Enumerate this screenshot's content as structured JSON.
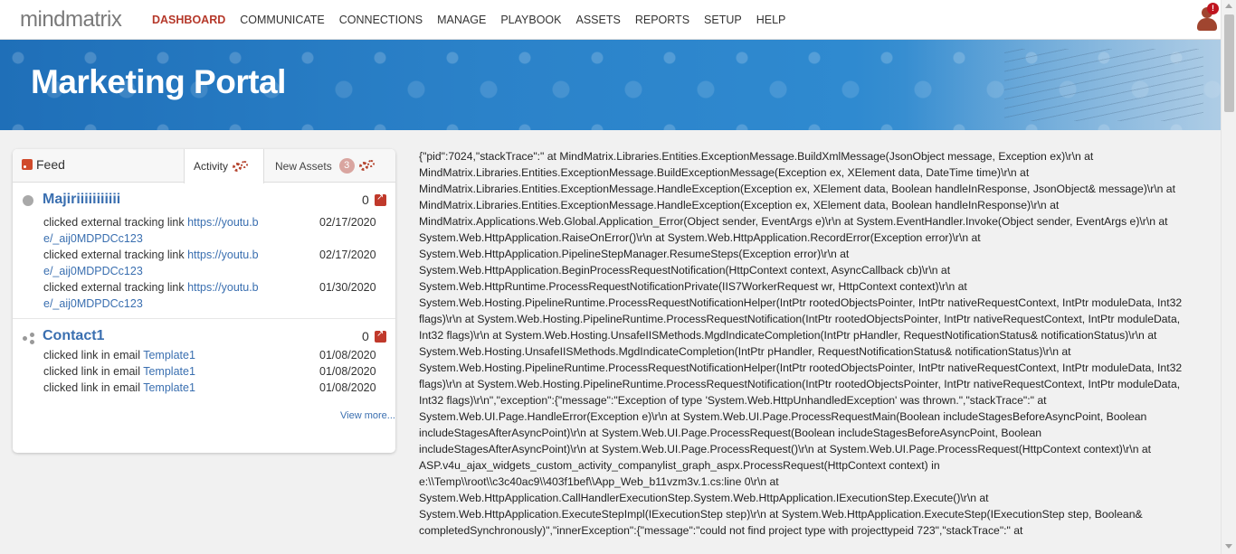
{
  "brand": {
    "logo_text": "mindmatrix"
  },
  "nav": {
    "items": [
      "DASHBOARD",
      "COMMUNICATE",
      "CONNECTIONS",
      "MANAGE",
      "PLAYBOOK",
      "ASSETS",
      "REPORTS",
      "SETUP",
      "HELP"
    ],
    "active": "DASHBOARD"
  },
  "user": {
    "alert_badge": "!"
  },
  "hero": {
    "title": "Marketing Portal"
  },
  "feed": {
    "title": "Feed",
    "tabs": {
      "activity": "Activity",
      "new_assets": "New Assets",
      "new_assets_count": "3"
    },
    "items": [
      {
        "name": "Majiriiiiiiiiiii",
        "count": "0",
        "activities": [
          {
            "text": "clicked external tracking link ",
            "link_line1": "https://youtu.b",
            "link_line2": "e/_aij0MDPDCc123",
            "date": "02/17/2020"
          },
          {
            "text": "clicked external tracking link ",
            "link_line1": "https://youtu.b",
            "link_line2": "e/_aij0MDPDCc123",
            "date": "02/17/2020"
          },
          {
            "text": "clicked external tracking link ",
            "link_line1": "https://youtu.b",
            "link_line2": "e/_aij0MDPDCc123",
            "date": "01/30/2020"
          }
        ]
      },
      {
        "name": "Contact1",
        "count": "0",
        "activities": [
          {
            "text": "clicked link in email ",
            "link": "Template1",
            "date": "01/08/2020"
          },
          {
            "text": "clicked link in email ",
            "link": "Template1",
            "date": "01/08/2020"
          },
          {
            "text": "clicked link in email ",
            "link": "Template1",
            "date": "01/08/2020"
          }
        ]
      }
    ],
    "view_more": "View more..."
  },
  "error_text": "{\"pid\":7024,\"stackTrace\":\" at MindMatrix.Libraries.Entities.ExceptionMessage.BuildXmlMessage(JsonObject message, Exception ex)\\r\\n at MindMatrix.Libraries.Entities.ExceptionMessage.BuildExceptionMessage(Exception ex, XElement data, DateTime time)\\r\\n at MindMatrix.Libraries.Entities.ExceptionMessage.HandleException(Exception ex, XElement data, Boolean handleInResponse, JsonObject& message)\\r\\n at MindMatrix.Libraries.Entities.ExceptionMessage.HandleException(Exception ex, XElement data, Boolean handleInResponse)\\r\\n at MindMatrix.Applications.Web.Global.Application_Error(Object sender, EventArgs e)\\r\\n at System.EventHandler.Invoke(Object sender, EventArgs e)\\r\\n at System.Web.HttpApplication.RaiseOnError()\\r\\n at System.Web.HttpApplication.RecordError(Exception error)\\r\\n at System.Web.HttpApplication.PipelineStepManager.ResumeSteps(Exception error)\\r\\n at System.Web.HttpApplication.BeginProcessRequestNotification(HttpContext context, AsyncCallback cb)\\r\\n at System.Web.HttpRuntime.ProcessRequestNotificationPrivate(IIS7WorkerRequest wr, HttpContext context)\\r\\n at System.Web.Hosting.PipelineRuntime.ProcessRequestNotificationHelper(IntPtr rootedObjectsPointer, IntPtr nativeRequestContext, IntPtr moduleData, Int32 flags)\\r\\n at System.Web.Hosting.PipelineRuntime.ProcessRequestNotification(IntPtr rootedObjectsPointer, IntPtr nativeRequestContext, IntPtr moduleData, Int32 flags)\\r\\n at System.Web.Hosting.UnsafeIISMethods.MgdIndicateCompletion(IntPtr pHandler, RequestNotificationStatus& notificationStatus)\\r\\n at System.Web.Hosting.UnsafeIISMethods.MgdIndicateCompletion(IntPtr pHandler, RequestNotificationStatus& notificationStatus)\\r\\n at System.Web.Hosting.PipelineRuntime.ProcessRequestNotificationHelper(IntPtr rootedObjectsPointer, IntPtr nativeRequestContext, IntPtr moduleData, Int32 flags)\\r\\n at System.Web.Hosting.PipelineRuntime.ProcessRequestNotification(IntPtr rootedObjectsPointer, IntPtr nativeRequestContext, IntPtr moduleData, Int32 flags)\\r\\n\",\"exception\":{\"message\":\"Exception of type 'System.Web.HttpUnhandledException' was thrown.\",\"stackTrace\":\" at System.Web.UI.Page.HandleError(Exception e)\\r\\n at System.Web.UI.Page.ProcessRequestMain(Boolean includeStagesBeforeAsyncPoint, Boolean includeStagesAfterAsyncPoint)\\r\\n at System.Web.UI.Page.ProcessRequest(Boolean includeStagesBeforeAsyncPoint, Boolean includeStagesAfterAsyncPoint)\\r\\n at System.Web.UI.Page.ProcessRequest()\\r\\n at System.Web.UI.Page.ProcessRequest(HttpContext context)\\r\\n at ASP.v4u_ajax_widgets_custom_activity_companylist_graph_aspx.ProcessRequest(HttpContext context) in e:\\\\Temp\\\\root\\\\c3c40ac9\\\\403f1bef\\\\App_Web_b11vzm3v.1.cs:line 0\\r\\n at System.Web.HttpApplication.CallHandlerExecutionStep.System.Web.HttpApplication.IExecutionStep.Execute()\\r\\n at System.Web.HttpApplication.ExecuteStepImpl(IExecutionStep step)\\r\\n at System.Web.HttpApplication.ExecuteStep(IExecutionStep step, Boolean& completedSynchronously)\",\"innerException\":{\"message\":\"could not find project type with projecttypeid 723\",\"stackTrace\":\" at"
}
